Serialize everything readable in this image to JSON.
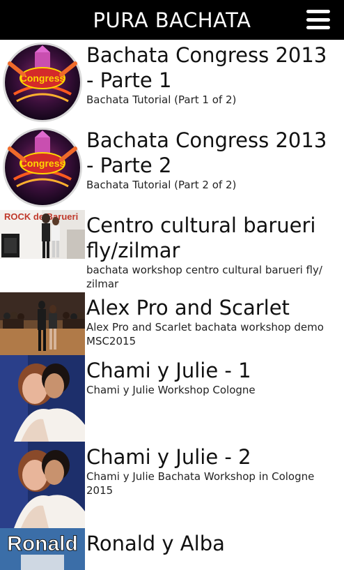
{
  "appbar": {
    "title": "PURA BACHATA",
    "menu_icon": "hamburger-menu-icon"
  },
  "videos": [
    {
      "title": "Bachata Congress 2013 - Parte 1",
      "subtitle": "Bachata Tutorial (Part 1 of 2)",
      "thumbnail": "congress-logo",
      "logo_text": "Congress"
    },
    {
      "title": "Bachata Congress 2013 - Parte 2",
      "subtitle": "Bachata Tutorial (Part 2 of 2)",
      "thumbnail": "congress-logo",
      "logo_text": "Congress"
    },
    {
      "title": "Centro cultural barueri fly/zilmar",
      "subtitle": "bachata workshop centro cultural barueri fly/ zilmar",
      "thumbnail": "workshop-photo",
      "thumb_text": "ROCK de Barueri"
    },
    {
      "title": "Alex Pro and Scarlet",
      "subtitle": "Alex Pro and Scarlet bachata workshop demo MSC2015",
      "thumbnail": "dance-floor-photo"
    },
    {
      "title": "Chami y Julie - 1",
      "subtitle": "Chami y Julie Workshop Cologne",
      "thumbnail": "couple-photo"
    },
    {
      "title": "Chami y Julie - 2",
      "subtitle": "Chami y Julie Bachata Workshop in Cologne 2015",
      "thumbnail": "couple-photo"
    },
    {
      "title": "Ronald y Alba",
      "subtitle": "",
      "thumbnail": "ronald-photo",
      "thumb_text": "Ronald"
    }
  ]
}
